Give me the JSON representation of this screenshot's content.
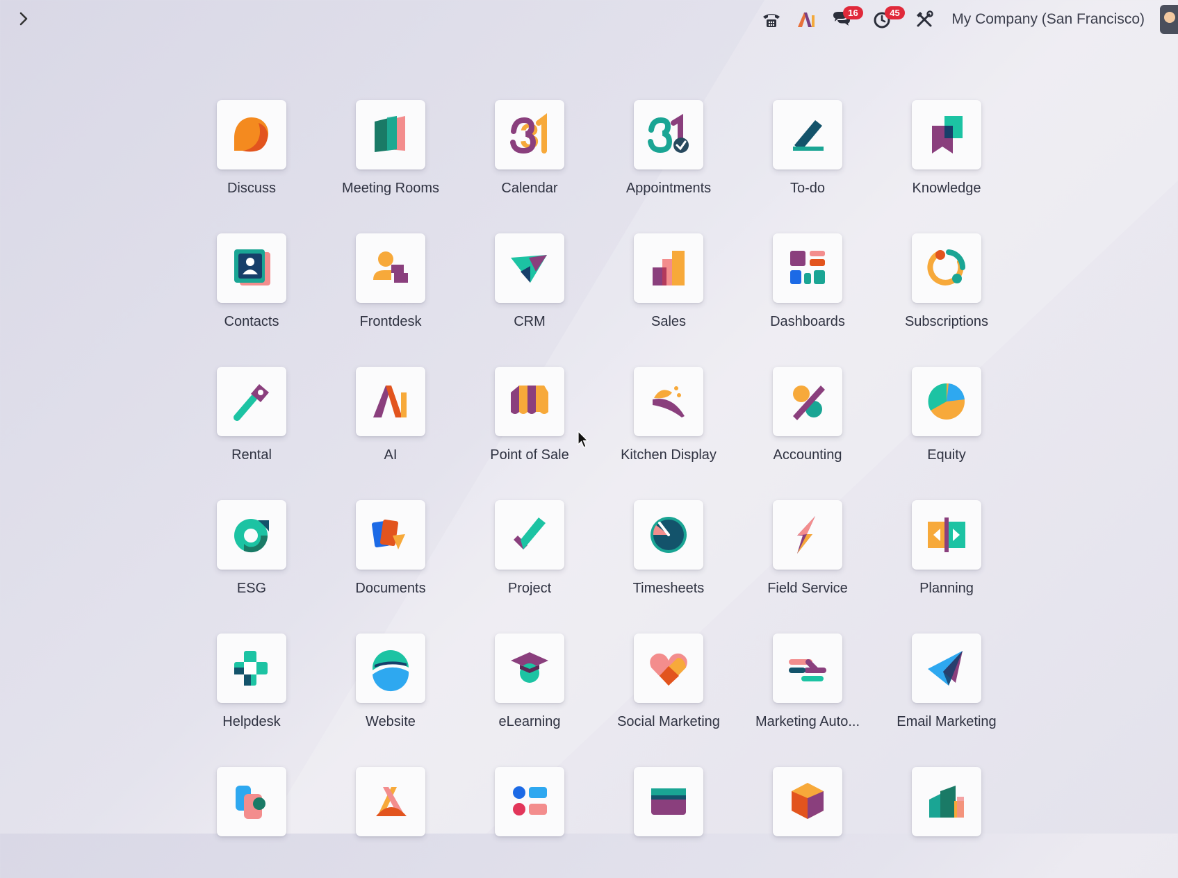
{
  "topbar": {
    "company": "My Company (San Francisco)",
    "icons": [
      "chevron-right-icon",
      "phone-icon",
      "ai-icon",
      "chat-icon",
      "activity-clock-icon",
      "tools-icon"
    ],
    "badges": {
      "messages": "16",
      "activities": "45"
    }
  },
  "apps": [
    {
      "label": "Discuss",
      "icon": "discuss-icon"
    },
    {
      "label": "Meeting Rooms",
      "icon": "meeting-rooms-icon"
    },
    {
      "label": "Calendar",
      "icon": "calendar-icon"
    },
    {
      "label": "Appointments",
      "icon": "appointments-icon"
    },
    {
      "label": "To-do",
      "icon": "todo-icon"
    },
    {
      "label": "Knowledge",
      "icon": "knowledge-icon"
    },
    {
      "label": "Contacts",
      "icon": "contacts-icon"
    },
    {
      "label": "Frontdesk",
      "icon": "frontdesk-icon"
    },
    {
      "label": "CRM",
      "icon": "crm-icon"
    },
    {
      "label": "Sales",
      "icon": "sales-icon"
    },
    {
      "label": "Dashboards",
      "icon": "dashboards-icon"
    },
    {
      "label": "Subscriptions",
      "icon": "subscriptions-icon"
    },
    {
      "label": "Rental",
      "icon": "rental-icon"
    },
    {
      "label": "AI",
      "icon": "ai-app-icon"
    },
    {
      "label": "Point of Sale",
      "icon": "point-of-sale-icon"
    },
    {
      "label": "Kitchen Display",
      "icon": "kitchen-display-icon"
    },
    {
      "label": "Accounting",
      "icon": "accounting-icon"
    },
    {
      "label": "Equity",
      "icon": "equity-icon"
    },
    {
      "label": "ESG",
      "icon": "esg-icon"
    },
    {
      "label": "Documents",
      "icon": "documents-icon"
    },
    {
      "label": "Project",
      "icon": "project-icon"
    },
    {
      "label": "Timesheets",
      "icon": "timesheets-icon"
    },
    {
      "label": "Field Service",
      "icon": "field-service-icon"
    },
    {
      "label": "Planning",
      "icon": "planning-icon"
    },
    {
      "label": "Helpdesk",
      "icon": "helpdesk-icon"
    },
    {
      "label": "Website",
      "icon": "website-icon"
    },
    {
      "label": "eLearning",
      "icon": "elearning-icon"
    },
    {
      "label": "Social Marketing",
      "icon": "social-marketing-icon"
    },
    {
      "label": "Marketing Auto...",
      "icon": "marketing-automation-icon"
    },
    {
      "label": "Email Marketing",
      "icon": "email-marketing-icon"
    },
    {
      "label": "",
      "icon": "app-icon-shapes"
    },
    {
      "label": "",
      "icon": "app-icon-x"
    },
    {
      "label": "",
      "icon": "app-icon-dots"
    },
    {
      "label": "",
      "icon": "app-icon-card"
    },
    {
      "label": "",
      "icon": "app-icon-cube"
    },
    {
      "label": "",
      "icon": "app-icon-buildings"
    }
  ]
}
